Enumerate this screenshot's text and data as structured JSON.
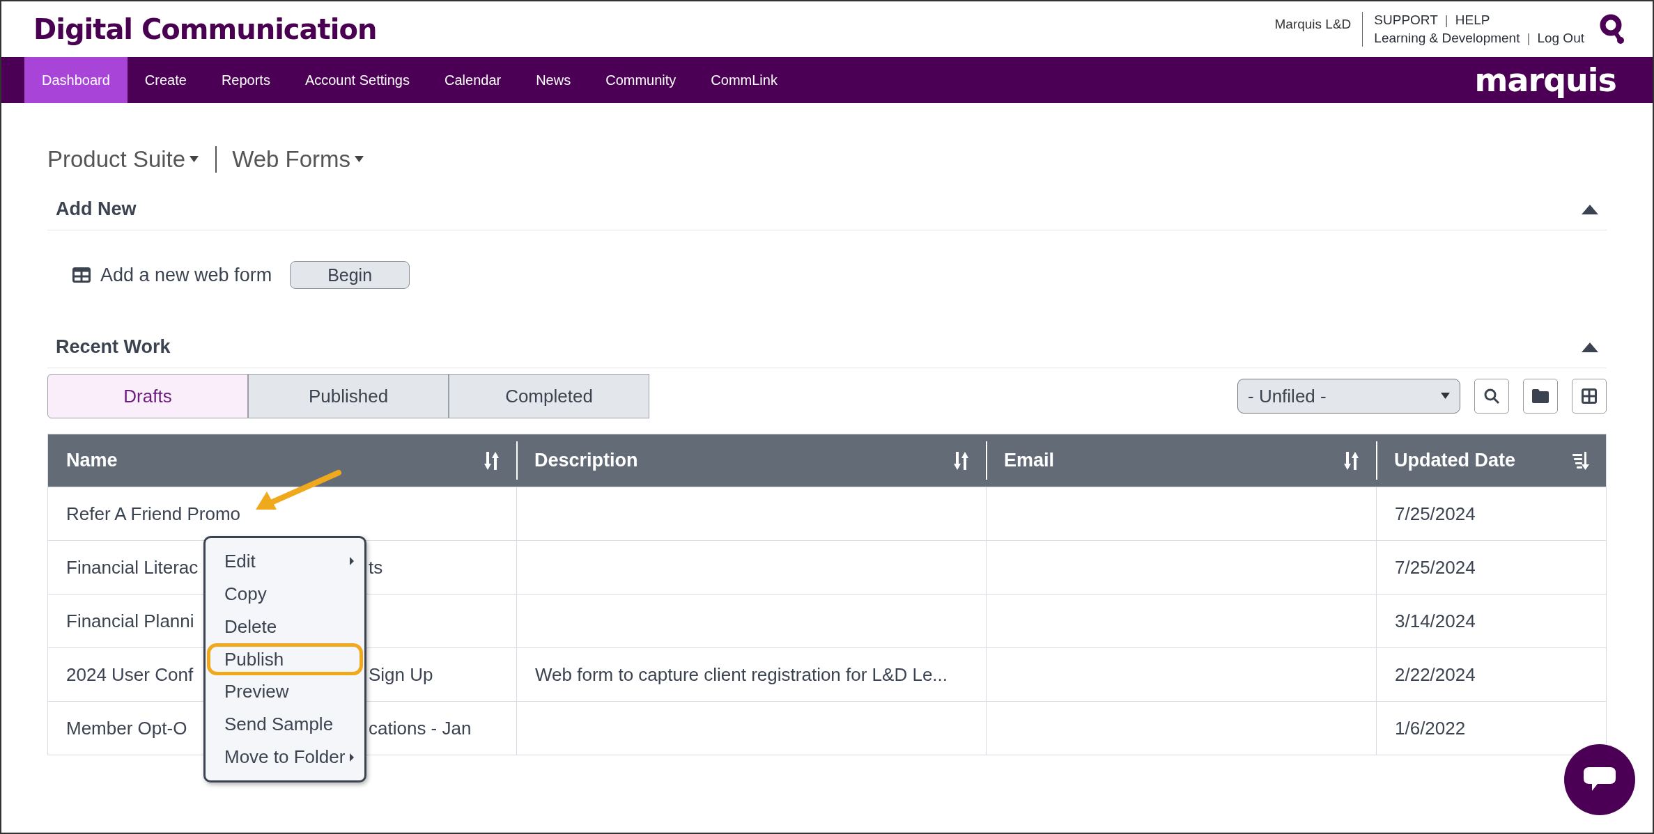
{
  "header": {
    "title": "Digital Communication",
    "account": "Marquis L&D",
    "links_top": [
      {
        "kind": "link",
        "text": "SUPPORT"
      },
      {
        "kind": "separator",
        "text": "|"
      },
      {
        "kind": "link",
        "text": "HELP"
      }
    ],
    "links_bottom": [
      {
        "kind": "link",
        "text": "Learning & Development"
      },
      {
        "kind": "separator",
        "text": "|"
      },
      {
        "kind": "link",
        "text": "Log Out"
      }
    ]
  },
  "nav": {
    "items": [
      {
        "label": "Dashboard",
        "selected": true
      },
      {
        "label": "Create",
        "selected": false
      },
      {
        "label": "Reports",
        "selected": false
      },
      {
        "label": "Account Settings",
        "selected": false
      },
      {
        "label": "Calendar",
        "selected": false
      },
      {
        "label": "News",
        "selected": false
      },
      {
        "label": "Community",
        "selected": false
      },
      {
        "label": "CommLink",
        "selected": false
      }
    ],
    "logo": "marquis"
  },
  "breadcrumb": [
    "Product Suite",
    "Web Forms"
  ],
  "add_new": {
    "title": "Add New",
    "label": "Add a new web form",
    "button": "Begin"
  },
  "recent_work": {
    "title": "Recent Work",
    "tabs": [
      {
        "label": "Drafts",
        "selected": true
      },
      {
        "label": "Published",
        "selected": false
      },
      {
        "label": "Completed",
        "selected": false
      }
    ],
    "folder_select": "- Unfiled -"
  },
  "table": {
    "columns": [
      {
        "label": "Name",
        "sorted": false
      },
      {
        "label": "Description",
        "sorted": false
      },
      {
        "label": "Email",
        "sorted": false
      },
      {
        "label": "Updated Date",
        "sorted": true
      }
    ],
    "rows": [
      {
        "name": "Refer A Friend Promo",
        "updated": "7/25/2024"
      },
      {
        "name": "Financial Literac",
        "name_after_menu": "ts",
        "updated": "7/25/2024"
      },
      {
        "name": "Financial Planni",
        "updated": "3/14/2024"
      },
      {
        "name": "2024 User Conf",
        "name_after_menu": "Sign Up",
        "description": "Web form to capture client registration for L&D Le...",
        "updated": "2/22/2024"
      },
      {
        "name": "Member Opt-O",
        "name_after_menu": "cations - Jan",
        "updated": "1/6/2022"
      }
    ]
  },
  "context_menu": {
    "items": [
      {
        "label": "Edit",
        "submenu": true,
        "highlighted": false
      },
      {
        "label": "Copy",
        "submenu": false,
        "highlighted": false
      },
      {
        "label": "Delete",
        "submenu": false,
        "highlighted": false
      },
      {
        "label": "Publish",
        "submenu": false,
        "highlighted": true
      },
      {
        "label": "Preview",
        "submenu": false,
        "highlighted": false
      },
      {
        "label": "Send Sample",
        "submenu": false,
        "highlighted": false
      },
      {
        "label": "Move to Folder",
        "submenu": true,
        "highlighted": false
      }
    ]
  }
}
